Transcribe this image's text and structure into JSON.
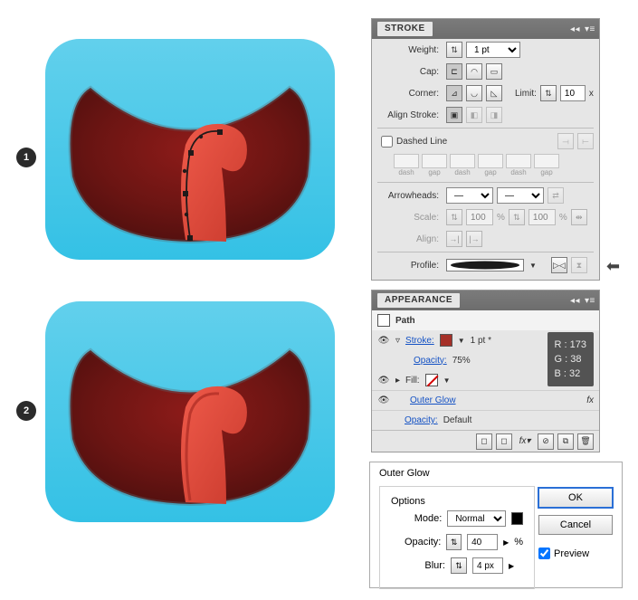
{
  "steps": {
    "one": "1",
    "two": "2"
  },
  "stroke": {
    "title": "STROKE",
    "weight_label": "Weight:",
    "weight_value": "1 pt",
    "cap_label": "Cap:",
    "corner_label": "Corner:",
    "limit_label": "Limit:",
    "limit_value": "10",
    "limit_suffix": "x",
    "align_label": "Align Stroke:",
    "dashed_label": "Dashed Line",
    "dash_cells": [
      "dash",
      "gap",
      "dash",
      "gap",
      "dash",
      "gap"
    ],
    "arrow_label": "Arrowheads:",
    "arrow_start": "—",
    "arrow_end": "—",
    "scale_label": "Scale:",
    "scale_start": "100",
    "scale_end": "100",
    "scale_pct": "%",
    "align_arrow_label": "Align:",
    "profile_label": "Profile:"
  },
  "appearance": {
    "title": "APPEARANCE",
    "object": "Path",
    "stroke_label": "Stroke:",
    "stroke_weight": "1 pt *",
    "opacity_label": "Opacity:",
    "opacity_value": "75%",
    "fill_label": "Fill:",
    "outer_glow": "Outer Glow",
    "opacity2_label": "Opacity:",
    "opacity2_value": "Default",
    "fx_glyph": "fx",
    "rgb": {
      "r": "R : 173",
      "g": "G : 38",
      "b": "B : 32"
    }
  },
  "dialog": {
    "title": "Outer Glow",
    "options": "Options",
    "mode_label": "Mode:",
    "mode_value": "Normal",
    "opacity_label": "Opacity:",
    "opacity_value": "40",
    "pct": "%",
    "blur_label": "Blur:",
    "blur_value": "4 px",
    "ok": "OK",
    "cancel": "Cancel",
    "preview": "Preview"
  }
}
